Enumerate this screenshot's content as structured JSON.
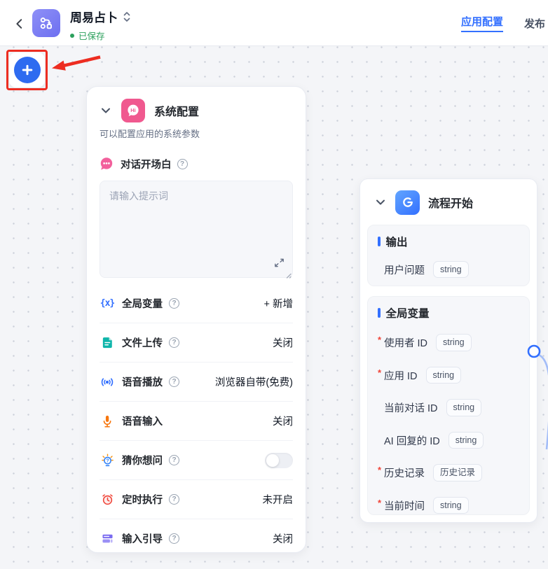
{
  "colors": {
    "accent_blue": "#3370ff",
    "saved_green": "#2ba05c",
    "annotation_red": "#ed2d21",
    "brand_pink": "#f0598f"
  },
  "header": {
    "title": "周易占卜",
    "saved_status": "已保存",
    "nav_app_config": "应用配置",
    "nav_publish": "发布"
  },
  "icons": {
    "help_glyph": "?",
    "variables_glyph": "{x}",
    "hi_glyph": "Hi"
  },
  "system_config_card": {
    "title": "系统配置",
    "subtitle": "可以配置应用的系统参数",
    "welcome_label": "对话开场白",
    "welcome_placeholder": "请输入提示词",
    "rows": [
      {
        "icon": "global-variables-icon",
        "label": "全局变量",
        "value": "+ 新增"
      },
      {
        "icon": "file-upload-icon",
        "label": "文件上传",
        "value": "关闭"
      },
      {
        "icon": "voice-play-icon",
        "label": "语音播放",
        "value": "浏览器自带(免费)"
      },
      {
        "icon": "voice-input-icon",
        "label": "语音输入",
        "value": "关闭"
      },
      {
        "icon": "guess-question-icon",
        "label": "猜你想问",
        "value": ""
      },
      {
        "icon": "scheduled-run-icon",
        "label": "定时执行",
        "value": "未开启"
      },
      {
        "icon": "input-guide-icon",
        "label": "输入引导",
        "value": "关闭"
      }
    ]
  },
  "flow_start_card": {
    "title": "流程开始",
    "output_section": {
      "title": "输出",
      "rows": [
        {
          "required_mark": "",
          "label": "用户问题",
          "badge": "string"
        }
      ]
    },
    "variables_section": {
      "title": "全局变量",
      "rows": [
        {
          "required_mark": "*",
          "label": "使用者 ID",
          "badge": "string"
        },
        {
          "required_mark": "*",
          "label": "应用 ID",
          "badge": "string"
        },
        {
          "required_mark": "",
          "label": "当前对话 ID",
          "badge": "string"
        },
        {
          "required_mark": "",
          "label": "AI 回复的 ID",
          "badge": "string"
        },
        {
          "required_mark": "*",
          "label": "历史记录",
          "badge": "历史记录"
        },
        {
          "required_mark": "*",
          "label": "当前时间",
          "badge": "string"
        }
      ]
    }
  }
}
